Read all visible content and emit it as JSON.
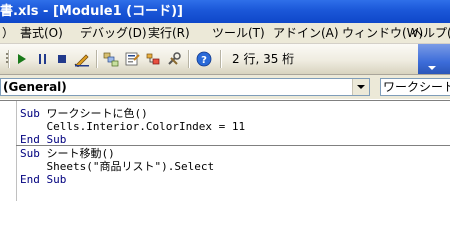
{
  "window": {
    "title": "書.xls - [Module1 (コード)]"
  },
  "menu": {
    "items": [
      "）",
      "書式(O)",
      "デバッグ(D)",
      "実行(R)",
      "ツール(T)",
      "アドイン(A)",
      "ウィンドウ(W)",
      "ヘルプ(H"
    ]
  },
  "toolbar": {
    "position_text": "2 行, 35 桁",
    "icons": [
      "toolbar-grip-icon",
      "run-icon",
      "pause-icon",
      "stop-icon",
      "design-mode-icon",
      "project-explorer-icon",
      "properties-icon",
      "object-browser-icon",
      "toolbox-icon",
      "help-icon"
    ]
  },
  "combos": {
    "object_value": "(General)",
    "procedure_value": "ワークシート"
  },
  "code": {
    "procedures": [
      {
        "lines": [
          {
            "keyword": "Sub ",
            "text": "ワークシートに色()"
          },
          {
            "keyword": "",
            "text": "    Cells.Interior.ColorIndex = 11"
          },
          {
            "keyword": "End Sub",
            "text": ""
          }
        ]
      },
      {
        "lines": [
          {
            "keyword": "Sub ",
            "text": "シート移動()"
          },
          {
            "keyword": "",
            "text": "    Sheets(\"商品リスト\").Select"
          },
          {
            "keyword": "End Sub",
            "text": ""
          }
        ]
      }
    ]
  },
  "colors": {
    "titlebar": "#1b57d8",
    "keyword": "#00007f",
    "menu_bg": "#ece9d8"
  }
}
